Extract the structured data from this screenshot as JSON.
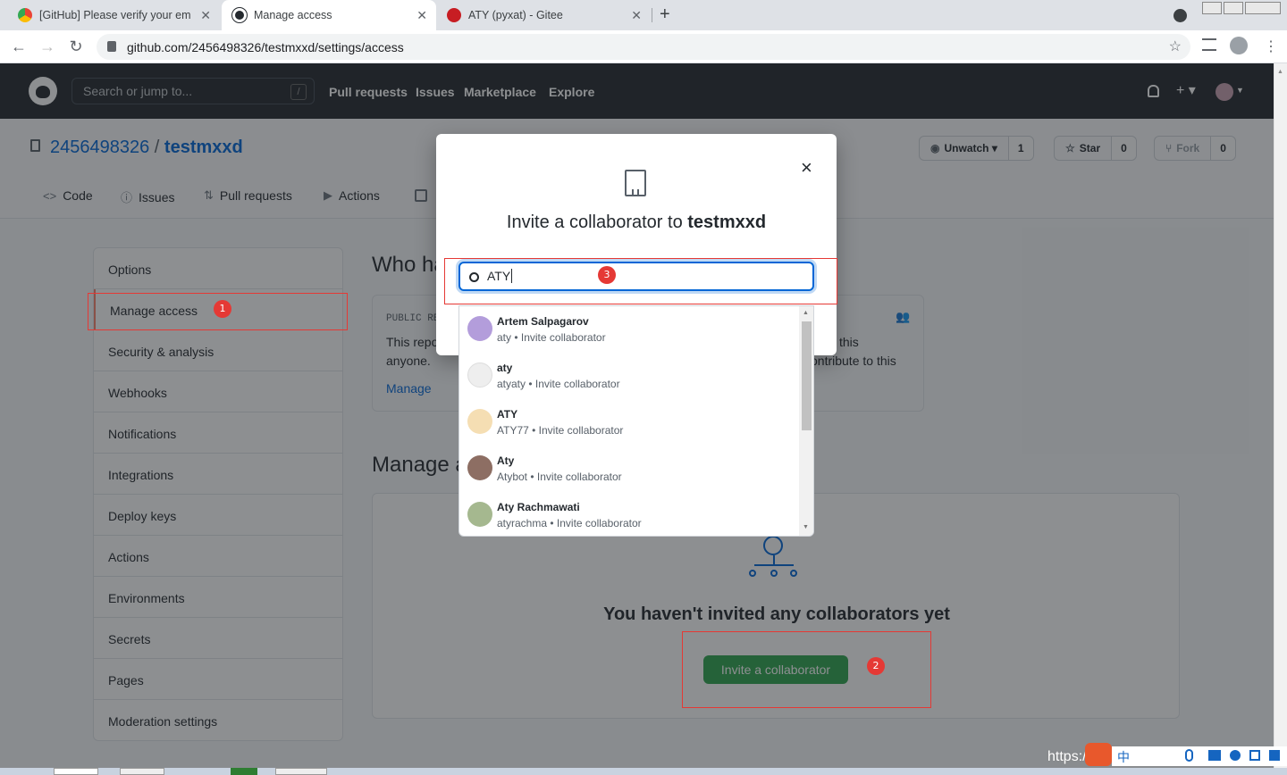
{
  "browser": {
    "tabs": [
      {
        "title": "[GitHub] Please verify your em",
        "close": "✕"
      },
      {
        "title": "Manage access",
        "close": "✕"
      },
      {
        "title": "ATY (pyxat) - Gitee",
        "close": "✕"
      }
    ],
    "new_tab": "+",
    "url": "github.com/2456498326/testmxxd/settings/access"
  },
  "gh_header": {
    "search_placeholder": "Search or jump to...",
    "search_shortcut": "/",
    "nav": [
      "Pull requests",
      "Issues",
      "Marketplace",
      "Explore"
    ],
    "plus": "+ ▾"
  },
  "repo": {
    "owner": "2456498326",
    "sep": "/",
    "name": "testmxxd",
    "watch_label": "Unwatch ▾",
    "watch_count": "1",
    "star_label": "Star",
    "star_count": "0",
    "fork_label": "Fork",
    "fork_count": "0",
    "tabs": [
      "Code",
      "Issues",
      "Pull requests",
      "Actions"
    ]
  },
  "sidebar": {
    "items": [
      "Options",
      "Manage access",
      "Security & analysis",
      "Webhooks",
      "Notifications",
      "Integrations",
      "Deploy keys",
      "Actions",
      "Environments",
      "Secrets",
      "Pages",
      "Moderation settings"
    ]
  },
  "main": {
    "who_heading": "Who ha",
    "public_label": "PUBLIC RE",
    "public_text_1": "This repo",
    "public_text_2": "anyone.",
    "public_text_right_1": "this",
    "public_text_right_2": "ontribute to this",
    "manage_link": "Manage",
    "manage_heading": "Manage a",
    "empty_text": "You haven't invited any collaborators yet",
    "invite_button": "Invite a collaborator"
  },
  "modal": {
    "title_prefix": "Invite a collaborator to ",
    "title_repo": "testmxxd",
    "close": "×",
    "input_value": "ATY",
    "results": [
      {
        "name": "Artem Salpagarov",
        "login": "aty",
        "action": " • Invite collaborator",
        "color": "#b39ddb"
      },
      {
        "name": "aty",
        "login": "atyaty",
        "action": " • Invite collaborator",
        "color": "#eeeeee"
      },
      {
        "name": "ATY",
        "login": "ATY77",
        "action": " • Invite collaborator",
        "color": "#f5deb3"
      },
      {
        "name": "Aty",
        "login": "Atybot",
        "action": " • Invite collaborator",
        "color": "#8d6e63"
      },
      {
        "name": "Aty Rachmawati",
        "login": "atyrachma",
        "action": " • Invite collaborator",
        "color": "#a5b88f"
      }
    ]
  },
  "annotations": {
    "badge1": "1",
    "badge2": "2",
    "badge3": "3"
  },
  "watermark": "https://b",
  "ime": "中"
}
